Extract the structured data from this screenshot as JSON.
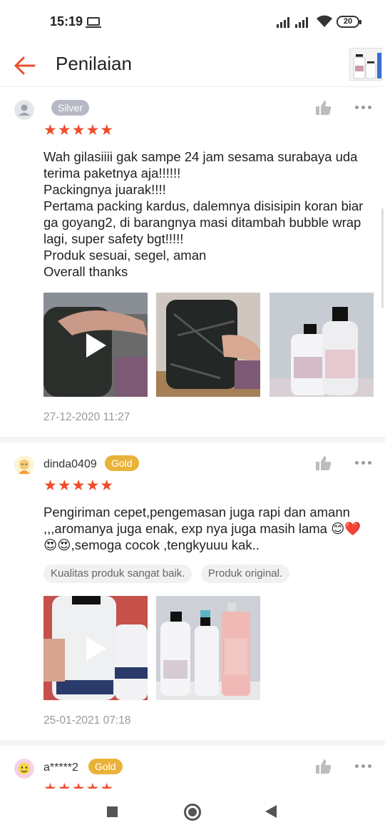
{
  "status_bar": {
    "time": "15:19",
    "battery": "20"
  },
  "app_bar": {
    "title": "Penilaian"
  },
  "reviews": [
    {
      "username": "",
      "badge": "Silver",
      "stars": "★★★★★",
      "text": "Wah gilasiiii gak sampe 24 jam sesama surabaya uda terima paketnya aja!!!!!!\nPackingnya juarak!!!!\nPertama packing kardus, dalemnya disisipin koran biar ga goyang2, di barangnya masi ditambah bubble wrap lagi, super safety bgt!!!!!\nProduk sesuai, segel, aman\nOverall thanks",
      "tags": [],
      "timestamp": "27-12-2020 11:27"
    },
    {
      "username": "dinda0409",
      "badge": "Gold",
      "stars": "★★★★★",
      "text": "Pengiriman cepet,pengemasan juga rapi dan amann ,,,aromanya juga enak, exp nya juga masih lama 😊❤️😍😍,semoga cocok ,tengkyuuu kak..",
      "tags": [
        "Kualitas produk sangat baik.",
        "Produk original."
      ],
      "timestamp": "25-01-2021 07:18"
    },
    {
      "username": "a*****2",
      "badge": "Gold",
      "stars": "★★★★★"
    }
  ],
  "colors": {
    "accent": "#ee4d2d",
    "silver": "#b6b9c3",
    "gold": "#e9b33a"
  }
}
